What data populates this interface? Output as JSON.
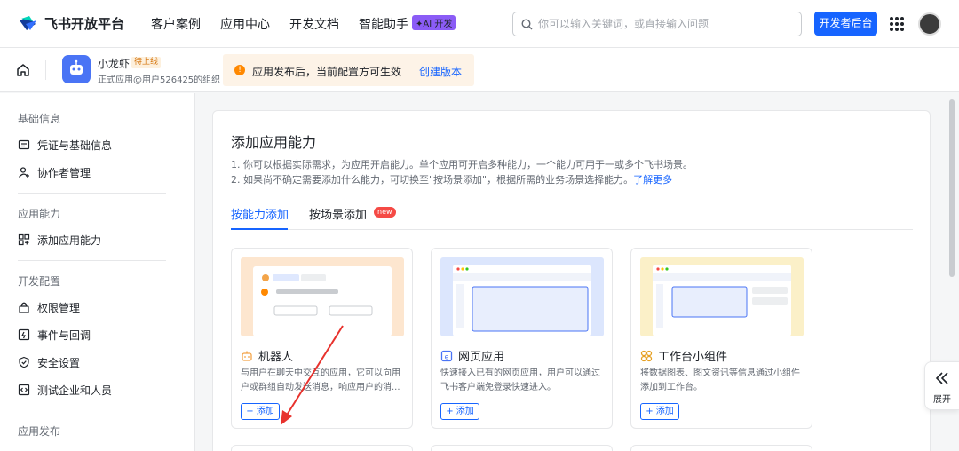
{
  "brand": {
    "name": "飞书开放平台"
  },
  "nav": {
    "items": [
      "客户案例",
      "应用中心",
      "开发文档",
      "智能助手"
    ],
    "ai_badge": "✦AI 开发"
  },
  "search": {
    "placeholder": "你可以输入关键词，或直接输入问题"
  },
  "header": {
    "dev_console": "开发者后台"
  },
  "app": {
    "name": "小龙虾",
    "status": "待上线",
    "subtitle": "正式应用@用户526425的组织"
  },
  "notice": {
    "text": "应用发布后，当前配置方可生效",
    "link": "创建版本"
  },
  "sidebar": {
    "groups": [
      "基础信息",
      "应用能力",
      "开发配置",
      "应用发布"
    ],
    "items": [
      "凭证与基础信息",
      "协作者管理",
      "添加应用能力",
      "权限管理",
      "事件与回调",
      "安全设置",
      "测试企业和人员"
    ]
  },
  "main": {
    "title": "添加应用能力",
    "desc1": "1. 你可以根据实际需求，为应用开启能力。单个应用可开启多种能力，一个能力可用于一或多个飞书场景。",
    "desc2": "2. 如果尚不确定需要添加什么能力，可切换至\"按场景添加\"，根据所需的业务场景选择能力。",
    "desc2_link": "了解更多",
    "tabs": [
      "按能力添加",
      "按场景添加"
    ],
    "new_badge": "new"
  },
  "cards": [
    {
      "title": "机器人",
      "desc": "与用户在聊天中交互的应用，它可以向用户或群组自动发送消息，响应用户的消...",
      "add": "+ 添加",
      "accent": "#f3a449"
    },
    {
      "title": "网页应用",
      "desc": "快速接入已有的网页应用，用户可以通过飞书客户端免登录快速进入。",
      "add": "+ 添加",
      "accent": "#4a74f5"
    },
    {
      "title": "工作台小组件",
      "desc": "将数据图表、图文资讯等信息通过小组件添加到工作台。",
      "add": "+ 添加",
      "accent": "#e6a123"
    }
  ],
  "expand": {
    "label": "展开"
  },
  "colors": {
    "primary": "#1664ff",
    "warning": "#ff8800"
  }
}
